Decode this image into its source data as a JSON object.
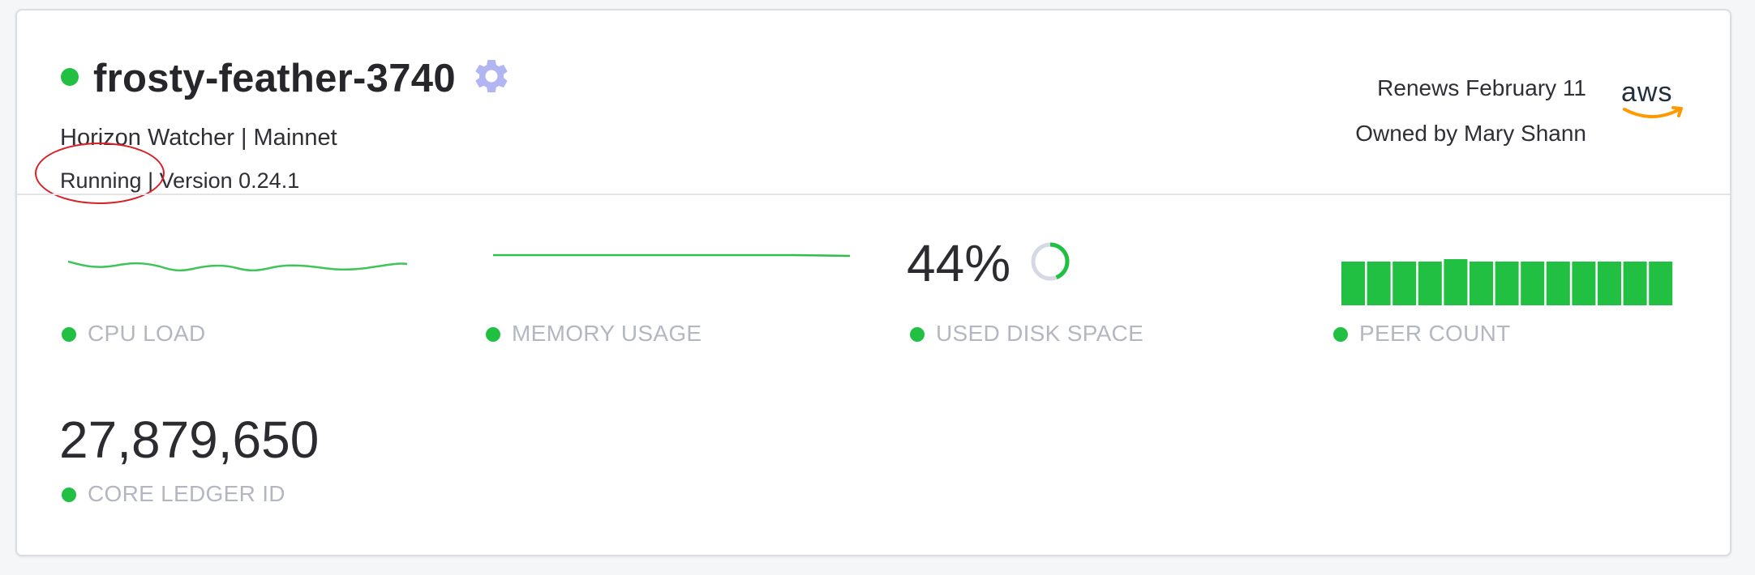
{
  "node": {
    "name": "frosty-feather-3740",
    "subtitle": "Horizon Watcher | Mainnet",
    "status_text": "Running | Version 0.24.1",
    "renews": "Renews February 11",
    "owner": "Owned by Mary Shann",
    "provider": "aws"
  },
  "metrics": {
    "cpu_label": "CPU LOAD",
    "memory_label": "MEMORY USAGE",
    "disk_label": "USED DISK SPACE",
    "disk_value": "44%",
    "disk_fraction": 0.44,
    "peer_label": "PEER COUNT",
    "ledger_value": "27,879,650",
    "ledger_label": "CORE LEDGER ID"
  },
  "colors": {
    "status_green": "#21c043",
    "gear": "#b1b6f2",
    "highlight_red": "#d81f26",
    "label_gray": "#b4b7c1"
  }
}
